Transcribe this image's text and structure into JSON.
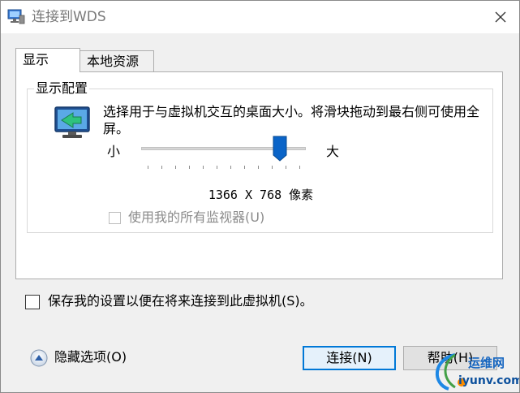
{
  "window": {
    "title": "连接到WDS",
    "icon": "remote-desktop-icon"
  },
  "tabs": [
    {
      "label": "显示",
      "active": true
    },
    {
      "label": "本地资源",
      "active": false
    }
  ],
  "display": {
    "group_label": "显示配置",
    "description": "选择用于与虚拟机交互的桌面大小。将滑块拖动到最右侧可使用全屏。",
    "small_label": "小",
    "large_label": "大",
    "slider_value_fraction": 0.84,
    "resolution": "1366 X 768 像素",
    "all_monitors_label": "使用我的所有监视器(U)",
    "all_monitors_checked": false
  },
  "save_settings": {
    "label": "保存我的设置以便在将来连接到此虚拟机(S)。",
    "checked": false
  },
  "footer": {
    "hide_options_label": "隐藏选项(O)",
    "connect_label": "连接(N)",
    "help_label": "帮助(H)"
  },
  "watermark": {
    "line1": "运维网",
    "line2": "iyunv.com"
  },
  "colors": {
    "accent": "#0078d7",
    "slider_thumb": "#0a64c8"
  }
}
